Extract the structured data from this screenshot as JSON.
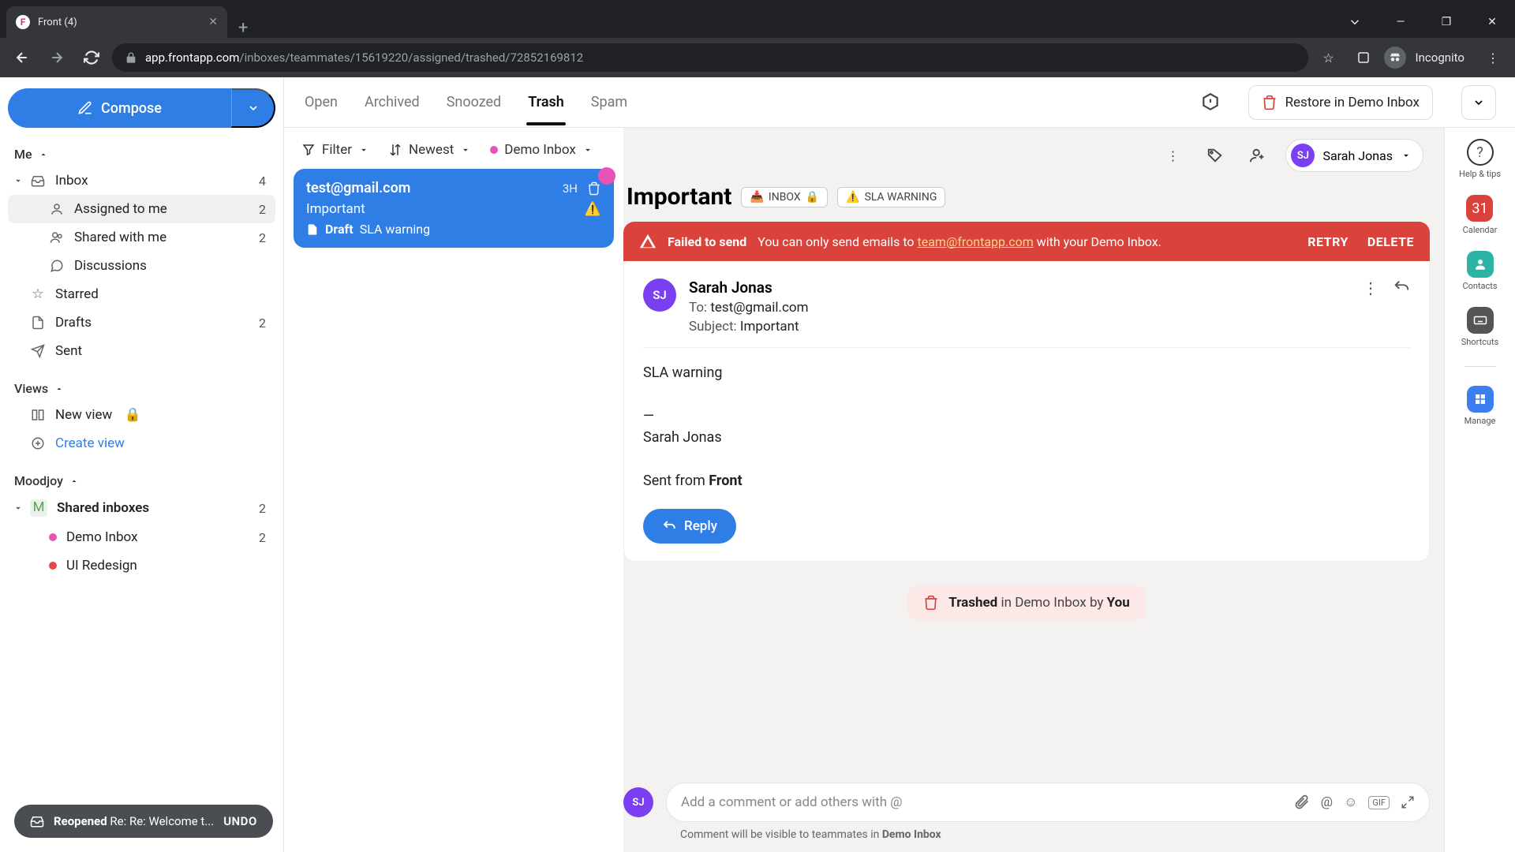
{
  "browser": {
    "tab_title": "Front (4)",
    "url_domain": "app.frontapp.com",
    "url_path": "/inboxes/teammates/15619220/assigned/trashed/72852169812",
    "incognito_label": "Incognito"
  },
  "compose_label": "Compose",
  "sidebar": {
    "me_label": "Me",
    "inbox": {
      "label": "Inbox",
      "count": "4"
    },
    "assigned": {
      "label": "Assigned to me",
      "count": "2"
    },
    "shared": {
      "label": "Shared with me",
      "count": "2"
    },
    "discussions": {
      "label": "Discussions"
    },
    "starred": {
      "label": "Starred"
    },
    "drafts": {
      "label": "Drafts",
      "count": "2"
    },
    "sent": {
      "label": "Sent"
    },
    "views_label": "Views",
    "new_view": "New view",
    "create_view": "Create view",
    "moodjoy_label": "Moodjoy",
    "shared_inboxes": {
      "label": "Shared inboxes",
      "count": "2"
    },
    "demo_inbox": {
      "label": "Demo Inbox",
      "count": "2"
    },
    "ui_redesign": {
      "label": "UI Redesign"
    }
  },
  "toast": {
    "status": "Reopened",
    "title": "Re: Re: Welcome t...",
    "undo": "UNDO"
  },
  "tabs": {
    "open": "Open",
    "archived": "Archived",
    "snoozed": "Snoozed",
    "trash": "Trash",
    "spam": "Spam"
  },
  "restore_label": "Restore in Demo Inbox",
  "list_toolbar": {
    "filter": "Filter",
    "sort": "Newest",
    "inbox": "Demo Inbox"
  },
  "conversation": {
    "from": "test@gmail.com",
    "time": "3H",
    "subject": "Important",
    "draft_label": "Draft",
    "draft_preview": "SLA warning"
  },
  "msg_toolbar": {
    "user_initials": "SJ",
    "user_name": "Sarah Jonas"
  },
  "subject": "Important",
  "tags": {
    "inbox": "INBOX",
    "sla": "SLA WARNING"
  },
  "alert": {
    "title": "Failed to send",
    "text_before": "You can only send emails to ",
    "link": "team@frontapp.com",
    "text_after": " with your Demo Inbox.",
    "retry": "RETRY",
    "delete": "DELETE"
  },
  "email": {
    "avatar": "SJ",
    "name": "Sarah Jonas",
    "to_label": "To: ",
    "to": "test@gmail.com",
    "subject_label": "Subject: ",
    "subject": "Important",
    "body_line1": "SLA warning",
    "sig_dash": "—",
    "sig_name": "Sarah Jonas",
    "sent_from_prefix": "Sent from ",
    "sent_from_app": "Front",
    "reply": "Reply"
  },
  "trashed": {
    "strong": "Trashed",
    "mid": " in Demo Inbox by ",
    "who": "You"
  },
  "comment": {
    "placeholder": "Add a comment or add others with @",
    "note_prefix": "Comment will be visible to teammates in ",
    "note_strong": "Demo Inbox"
  },
  "rail": {
    "help": "Help & tips",
    "calendar": "Calendar",
    "calendar_day": "31",
    "contacts": "Contacts",
    "shortcuts": "Shortcuts",
    "manage": "Manage"
  }
}
